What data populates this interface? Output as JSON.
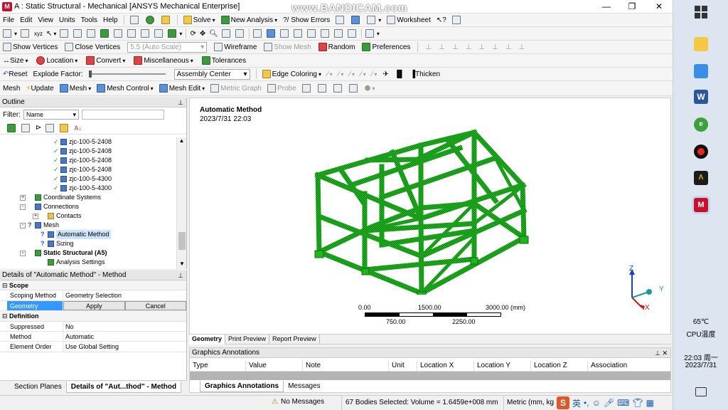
{
  "window": {
    "title": "A : Static Structural - Mechanical [ANSYS Mechanical Enterprise]",
    "watermark": "www.BANDICAM.com",
    "app_icon_letter": "M"
  },
  "menu": [
    "File",
    "Edit",
    "View",
    "Units",
    "Tools",
    "Help"
  ],
  "toolbar1": {
    "solve": "Solve",
    "new_analysis": "New Analysis",
    "show_errors": "?/ Show Errors",
    "worksheet": "Worksheet"
  },
  "toolbar3": {
    "show_vertices": "Show Vertices",
    "close_vertices": "Close Vertices",
    "auto_scale": "5.5 (Auto Scale)",
    "wireframe": "Wireframe",
    "show_mesh": "Show Mesh",
    "random": "Random",
    "preferences": "Preferences"
  },
  "toolbar4": {
    "size": "Size",
    "location": "Location",
    "convert": "Convert",
    "miscellaneous": "Miscellaneous",
    "tolerances": "Tolerances"
  },
  "toolbar5": {
    "reset": "Reset",
    "explode_factor": "Explode Factor:",
    "assembly_center": "Assembly Center",
    "edge_coloring": "Edge Coloring",
    "thicken": "Thicken"
  },
  "toolbar6": {
    "mesh": "Mesh",
    "update": "Update",
    "mesh_dd": "Mesh",
    "mesh_control": "Mesh Control",
    "mesh_edit": "Mesh Edit",
    "metric_graph": "Metric Graph",
    "probe": "Probe"
  },
  "outline": {
    "header": "Outline",
    "filter_label": "Filter:",
    "filter_value": "Name",
    "tree": [
      {
        "label": "zjc-100-5-2408",
        "indent": 3,
        "check": true,
        "icon": "body"
      },
      {
        "label": "zjc-100-5-2408",
        "indent": 3,
        "check": true,
        "icon": "body"
      },
      {
        "label": "zjc-100-5-2408",
        "indent": 3,
        "check": true,
        "icon": "body"
      },
      {
        "label": "zjc-100-5-2408",
        "indent": 3,
        "check": true,
        "icon": "body"
      },
      {
        "label": "zjc-100-5-4300",
        "indent": 3,
        "check": true,
        "icon": "body"
      },
      {
        "label": "zjc-100-5-4300",
        "indent": 3,
        "check": true,
        "icon": "body"
      },
      {
        "label": "Coordinate Systems",
        "indent": 1,
        "expand": "+",
        "icon": "coord"
      },
      {
        "label": "Connections",
        "indent": 1,
        "expand": "-",
        "icon": "conn"
      },
      {
        "label": "Contacts",
        "indent": 2,
        "expand": "+",
        "icon": "fold"
      },
      {
        "label": "Mesh",
        "indent": 1,
        "expand": "-",
        "icon": "mesh",
        "q": true
      },
      {
        "label": "Automatic Method",
        "indent": 2,
        "icon": "method",
        "q": true,
        "selected": true
      },
      {
        "label": "Sizing",
        "indent": 2,
        "icon": "method",
        "q": true
      },
      {
        "label": "Static Structural (A5)",
        "indent": 1,
        "expand": "-",
        "icon": "static",
        "bold": true
      },
      {
        "label": "Analysis Settings",
        "indent": 2,
        "icon": "analysis"
      }
    ]
  },
  "details": {
    "header": "Details of \"Automatic Method\" - Method",
    "scope_title": "Scope",
    "scoping_method_label": "Scoping Method",
    "scoping_method_value": "Geometry Selection",
    "geometry_label": "Geometry",
    "apply_label": "Apply",
    "cancel_label": "Cancel",
    "definition_title": "Definition",
    "suppressed_label": "Suppressed",
    "suppressed_value": "No",
    "method_label": "Method",
    "method_value": "Automatic",
    "element_order_label": "Element Order",
    "element_order_value": "Use Global Setting"
  },
  "left_tabs": {
    "section_planes": "Section Planes",
    "details_tab": "Details of \"Aut...thod\" - Method"
  },
  "viewport": {
    "title": "Automatic Method",
    "timestamp": "2023/7/31 22:03",
    "scale_top": [
      "0.00",
      "1500.00",
      "3000.00 (mm)"
    ],
    "scale_bottom": [
      "750.00",
      "2250.00"
    ],
    "axis_z": "Z",
    "axis_y": "Y",
    "axis_x": "X",
    "tabs": [
      "Geometry",
      "Print Preview",
      "Report Preview"
    ]
  },
  "graphics_annotations": {
    "header": "Graphics Annotations",
    "columns": [
      "Type",
      "Value",
      "Note",
      "Unit",
      "Location X",
      "Location Y",
      "Location Z",
      "Association"
    ],
    "tabs": [
      "Graphics Annotations",
      "Messages"
    ]
  },
  "status": {
    "messages": "No Messages",
    "selection": "67 Bodies Selected: Volume = 1.6459e+008 mm",
    "units": "Metric (mm, kg"
  },
  "taskbar": {
    "temp": "65℃",
    "cpu_label": "CPU温度",
    "time": "22:03 周一",
    "date": "2023/7/31",
    "ime": "英"
  },
  "colors": {
    "mesh_green": "#1fb51f",
    "selection_blue": "#3399ff"
  }
}
